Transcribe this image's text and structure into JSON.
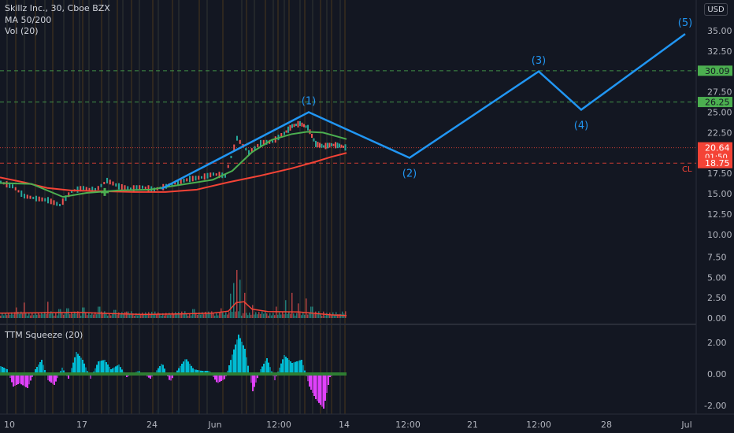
{
  "header": {
    "symbol_line": "Skillz Inc., 30, Cboe BZX",
    "ma_line": "MA 50/200",
    "vol_line": "Vol (20)",
    "squeeze_line": "TTM Squeeze (20)",
    "currency": "USD"
  },
  "colors": {
    "background": "#131722",
    "price_line": "#2196f3",
    "ma50": "#4caf50",
    "ma200": "#f44336",
    "candle_up": "#26a69a",
    "candle_down": "#ef5350",
    "squeeze_pos": "#00bcd4",
    "squeeze_neg": "#e040fb",
    "level_green": "#4caf50",
    "level_red": "#f44336"
  },
  "chart_data": {
    "type": "line",
    "price_axis": {
      "ticks": [
        "35.00",
        "32.50",
        "30.00",
        "27.50",
        "25.00",
        "22.50",
        "17.50",
        "15.00",
        "12.50",
        "10.00",
        "7.50",
        "5.00",
        "2.50",
        "0.00"
      ],
      "ylim": [
        8.8,
        37.2
      ]
    },
    "time_axis": {
      "ticks": [
        "10",
        "17",
        "24",
        "Jun",
        "12:00",
        "14",
        "12:00",
        "21",
        "12:00",
        "28",
        "Jul"
      ]
    },
    "elliott_wave": {
      "labels": [
        "(1)",
        "(2)",
        "(3)",
        "(4)",
        "(5)"
      ],
      "points": [
        {
          "t": 205,
          "p": 15.6
        },
        {
          "t": 392,
          "p": 25.0,
          "label": "(1)"
        },
        {
          "t": 520,
          "p": 19.4,
          "label": "(2)"
        },
        {
          "t": 684,
          "p": 30.0,
          "label": "(3)"
        },
        {
          "t": 738,
          "p": 25.3,
          "label": "(4)"
        },
        {
          "t": 870,
          "p": 34.6,
          "label": "(5)"
        }
      ]
    },
    "levels": [
      {
        "value": 30.09,
        "label": "30.09",
        "style": "green-dashed"
      },
      {
        "value": 26.25,
        "label": "26.25",
        "style": "green-dashed"
      },
      {
        "value": 20.64,
        "label": "20.64",
        "style": "red-dotted",
        "sub": "01:50"
      },
      {
        "value": 18.75,
        "label": "18.75",
        "style": "red-dashed",
        "tag": "CL"
      }
    ],
    "ma50": [
      [
        0,
        16.3
      ],
      [
        40,
        16.2
      ],
      [
        80,
        14.6
      ],
      [
        110,
        15.1
      ],
      [
        150,
        15.4
      ],
      [
        190,
        15.5
      ],
      [
        230,
        16.1
      ],
      [
        270,
        16.7
      ],
      [
        295,
        17.8
      ],
      [
        320,
        20.1
      ],
      [
        345,
        21.6
      ],
      [
        370,
        22.3
      ],
      [
        390,
        22.6
      ],
      [
        410,
        22.5
      ],
      [
        440,
        21.7
      ]
    ],
    "ma200": [
      [
        0,
        17.0
      ],
      [
        30,
        16.4
      ],
      [
        60,
        15.7
      ],
      [
        90,
        15.4
      ],
      [
        130,
        15.3
      ],
      [
        170,
        15.2
      ],
      [
        210,
        15.2
      ],
      [
        250,
        15.5
      ],
      [
        290,
        16.4
      ],
      [
        330,
        17.2
      ],
      [
        370,
        18.1
      ],
      [
        400,
        18.9
      ],
      [
        420,
        19.5
      ],
      [
        440,
        20.0
      ]
    ],
    "candles_close": [
      [
        0,
        16.4
      ],
      [
        15,
        15.9
      ],
      [
        30,
        14.7
      ],
      [
        45,
        14.4
      ],
      [
        60,
        14.2
      ],
      [
        75,
        13.6
      ],
      [
        90,
        15.3
      ],
      [
        105,
        15.7
      ],
      [
        120,
        15.4
      ],
      [
        135,
        16.6
      ],
      [
        150,
        15.9
      ],
      [
        165,
        15.6
      ],
      [
        180,
        15.8
      ],
      [
        195,
        15.5
      ],
      [
        210,
        15.9
      ],
      [
        225,
        16.4
      ],
      [
        240,
        16.8
      ],
      [
        255,
        17.0
      ],
      [
        270,
        17.4
      ],
      [
        285,
        17.2
      ],
      [
        300,
        21.8
      ],
      [
        315,
        20.0
      ],
      [
        330,
        21.2
      ],
      [
        345,
        21.4
      ],
      [
        360,
        22.4
      ],
      [
        370,
        23.3
      ],
      [
        380,
        23.6
      ],
      [
        390,
        23.1
      ],
      [
        400,
        21.1
      ],
      [
        410,
        20.8
      ],
      [
        420,
        21.0
      ],
      [
        430,
        20.9
      ],
      [
        440,
        20.6
      ]
    ],
    "volume": {
      "axis_ticks": [
        "5.00",
        "2.50",
        "0.00"
      ],
      "ylim": [
        0,
        6.2
      ],
      "avg": [
        [
          0,
          0.6
        ],
        [
          60,
          0.65
        ],
        [
          100,
          0.7
        ],
        [
          140,
          0.55
        ],
        [
          180,
          0.45
        ],
        [
          220,
          0.5
        ],
        [
          270,
          0.6
        ],
        [
          290,
          0.85
        ],
        [
          300,
          1.9
        ],
        [
          310,
          2.0
        ],
        [
          320,
          1.1
        ],
        [
          340,
          0.8
        ],
        [
          380,
          0.75
        ],
        [
          420,
          0.4
        ],
        [
          440,
          0.3
        ]
      ],
      "spikes": [
        [
          20,
          1.3
        ],
        [
          30,
          1.9
        ],
        [
          60,
          2.0
        ],
        [
          75,
          1.1
        ],
        [
          85,
          1.2
        ],
        [
          105,
          1.3
        ],
        [
          125,
          1.4
        ],
        [
          145,
          1.0
        ],
        [
          160,
          0.8
        ],
        [
          200,
          0.7
        ],
        [
          245,
          1.1
        ],
        [
          280,
          1.2
        ],
        [
          292,
          3.0
        ],
        [
          296,
          4.3
        ],
        [
          300,
          5.9
        ],
        [
          304,
          4.7
        ],
        [
          310,
          3.1
        ],
        [
          320,
          1.6
        ],
        [
          350,
          1.4
        ],
        [
          362,
          2.2
        ],
        [
          370,
          3.1
        ],
        [
          378,
          1.8
        ],
        [
          388,
          2.4
        ],
        [
          395,
          1.4
        ],
        [
          410,
          0.8
        ],
        [
          430,
          0.5
        ]
      ]
    },
    "squeeze": {
      "axis_ticks": [
        "2.00",
        "0.00",
        "-2.00"
      ],
      "ylim": [
        -2.6,
        2.8
      ],
      "values": [
        [
          0,
          0.5
        ],
        [
          8,
          0.3
        ],
        [
          16,
          -0.8
        ],
        [
          24,
          -0.6
        ],
        [
          34,
          -0.9
        ],
        [
          44,
          0.3
        ],
        [
          52,
          0.9
        ],
        [
          60,
          -0.4
        ],
        [
          68,
          -0.7
        ],
        [
          78,
          0.4
        ],
        [
          86,
          -0.3
        ],
        [
          96,
          1.4
        ],
        [
          104,
          0.9
        ],
        [
          114,
          -0.3
        ],
        [
          124,
          0.8
        ],
        [
          132,
          0.9
        ],
        [
          140,
          0.3
        ],
        [
          150,
          0.6
        ],
        [
          160,
          -0.2
        ],
        [
          175,
          0.2
        ],
        [
          190,
          -0.3
        ],
        [
          205,
          0.7
        ],
        [
          215,
          -0.5
        ],
        [
          225,
          0.3
        ],
        [
          235,
          1.0
        ],
        [
          245,
          0.3
        ],
        [
          255,
          0.2
        ],
        [
          265,
          0.2
        ],
        [
          275,
          -0.6
        ],
        [
          285,
          -0.3
        ],
        [
          295,
          1.4
        ],
        [
          302,
          2.5
        ],
        [
          310,
          1.6
        ],
        [
          320,
          -1.1
        ],
        [
          330,
          0.3
        ],
        [
          338,
          1.0
        ],
        [
          348,
          -0.4
        ],
        [
          360,
          1.2
        ],
        [
          370,
          0.7
        ],
        [
          382,
          0.9
        ],
        [
          392,
          -0.8
        ],
        [
          400,
          -1.6
        ],
        [
          410,
          -2.2
        ],
        [
          418,
          -0.2
        ],
        [
          428,
          0.1
        ],
        [
          436,
          0.1
        ]
      ]
    }
  }
}
